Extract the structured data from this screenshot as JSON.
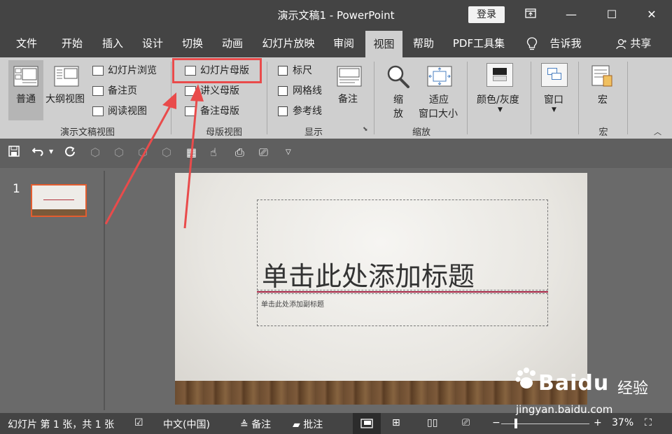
{
  "window": {
    "title": "演示文稿1  -  PowerPoint",
    "login": "登录",
    "minimize": "—",
    "restore": "⧉",
    "maximize": "☐",
    "close": "✕"
  },
  "tabs": [
    {
      "label": "文件",
      "active": false
    },
    {
      "label": "开始",
      "active": false
    },
    {
      "label": "插入",
      "active": false
    },
    {
      "label": "设计",
      "active": false
    },
    {
      "label": "切换",
      "active": false
    },
    {
      "label": "动画",
      "active": false
    },
    {
      "label": "幻灯片放映",
      "active": false
    },
    {
      "label": "审阅",
      "active": false
    },
    {
      "label": "视图",
      "active": true
    },
    {
      "label": "帮助",
      "active": false
    },
    {
      "label": "PDF工具集",
      "active": false
    },
    {
      "label": "告诉我",
      "active": false
    }
  ],
  "share": "共享",
  "ribbon": {
    "presentation_views": {
      "normal": "普通",
      "outline": "大纲视图",
      "slide_sorter": "幻灯片浏览",
      "notes_page": "备注页",
      "reading": "阅读视图",
      "label": "演示文稿视图"
    },
    "master_views": {
      "slide_master": "幻灯片母版",
      "handout_master": "讲义母版",
      "notes_master": "备注母版",
      "label": "母版视图"
    },
    "show": {
      "ruler": "标尺",
      "gridlines": "网格线",
      "guides": "参考线",
      "notes": "备注",
      "label": "显示"
    },
    "zoom": {
      "zoom": "缩放",
      "zoom_line2": "放",
      "zoom_line1": "缩",
      "fit_line1": "适应",
      "fit_line2": "窗口大小",
      "label": "缩放"
    },
    "color": {
      "label": "颜色/灰度"
    },
    "window": {
      "label": "窗口"
    },
    "macros": {
      "button": "宏",
      "label": "宏"
    }
  },
  "slide": {
    "number": "1",
    "title_placeholder": "单击此处添加标题",
    "subtitle_placeholder": "单击此处添加副标题"
  },
  "status": {
    "slide_info": "幻灯片 第 1 张，共 1 张",
    "language": "中文(中国)",
    "notes": "备注",
    "comments": "批注",
    "zoom_level": "37%",
    "zoom_minus": "−",
    "zoom_plus": "+"
  },
  "watermark": {
    "brand": "Bai",
    "brand2": "du",
    "suffix": "经验",
    "url": "jingyan.baidu.com"
  },
  "colors": {
    "titlebar": "#444444",
    "ribbon": "#cfcfcf",
    "highlight": "#e94b4b",
    "thumb_border": "#e35d2f"
  }
}
